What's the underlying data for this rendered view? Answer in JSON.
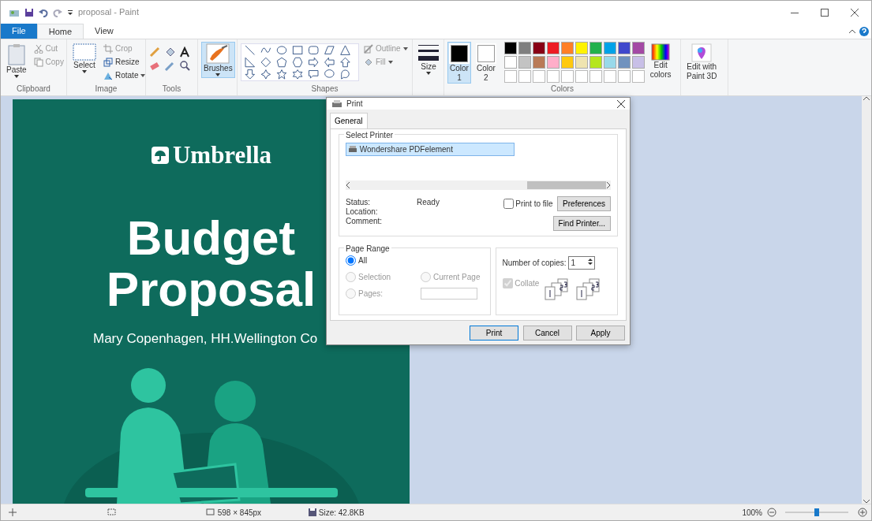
{
  "window": {
    "title": "proposal - Paint"
  },
  "menu_tabs": [
    {
      "label": "File",
      "kind": "file",
      "selected": false
    },
    {
      "label": "Home",
      "kind": "tab",
      "selected": true
    },
    {
      "label": "View",
      "kind": "tab",
      "selected": false
    }
  ],
  "ribbon": {
    "clipboard": {
      "label": "Clipboard",
      "paste": "Paste",
      "cut": {
        "label": "Cut",
        "disabled": true
      },
      "copy": {
        "label": "Copy",
        "disabled": true
      }
    },
    "image": {
      "label": "Image",
      "select": "Select",
      "crop": {
        "label": "Crop",
        "disabled": true
      },
      "resize": {
        "label": "Resize",
        "disabled": false
      },
      "rotate": {
        "label": "Rotate",
        "disabled": false
      }
    },
    "tools": {
      "label": "Tools"
    },
    "brushes": {
      "label": "Brushes",
      "selected": true
    },
    "shapes": {
      "label": "Shapes",
      "outline": {
        "label": "Outline",
        "disabled": true
      },
      "fill": {
        "label": "Fill",
        "disabled": true
      }
    },
    "size": {
      "label": "Size"
    },
    "color1": {
      "label": "Color",
      "sub": "1",
      "color": "#000000",
      "selected": true
    },
    "color2": {
      "label": "Color",
      "sub": "2",
      "color": "#ffffff",
      "selected": false
    },
    "colors": {
      "label": "Colors",
      "palette": [
        {
          "color": "#000000"
        },
        {
          "color": "#7f7f7f"
        },
        {
          "color": "#880015"
        },
        {
          "color": "#ed1c24"
        },
        {
          "color": "#ff7f27"
        },
        {
          "color": "#fff200"
        },
        {
          "color": "#22b14c"
        },
        {
          "color": "#00a2e8"
        },
        {
          "color": "#3f48cc"
        },
        {
          "color": "#a349a4"
        },
        {
          "color": "#ffffff"
        },
        {
          "color": "#c3c3c3"
        },
        {
          "color": "#b97a57"
        },
        {
          "color": "#ffaec9"
        },
        {
          "color": "#ffc90e"
        },
        {
          "color": "#efe4b0"
        },
        {
          "color": "#b5e61d"
        },
        {
          "color": "#99d9ea"
        },
        {
          "color": "#7092be"
        },
        {
          "color": "#c8bfe7"
        }
      ]
    },
    "edit_colors": [
      "Edit",
      "colors"
    ],
    "paint3d": [
      "Edit with",
      "Paint 3D"
    ]
  },
  "document": {
    "brand": "Umbrella",
    "title": [
      "Budget",
      "Proposal"
    ],
    "author": "Mary Copenhagen, HH.Wellington Co"
  },
  "dialog": {
    "title": "Print",
    "tabs": [
      {
        "label": "General",
        "selected": true
      }
    ],
    "select_printer": {
      "label": "Select Printer",
      "printers": [
        {
          "name": "Wondershare PDFelement",
          "selected": true
        }
      ]
    },
    "status": [
      {
        "label": "Status:",
        "value": "Ready"
      },
      {
        "label": "Location:"
      },
      {
        "label": "Comment:"
      }
    ],
    "print_to_file": {
      "label": "Print to file",
      "checked": false
    },
    "preferences": "Preferences",
    "find_printer": "Find Printer...",
    "page_range": {
      "label": "Page Range",
      "options": [
        {
          "label": "All",
          "selected": true,
          "disabled": false
        },
        {
          "label": "Selection",
          "selected": false,
          "disabled": true
        },
        {
          "label": "Current Page",
          "selected": false,
          "disabled": true
        },
        {
          "label": "Pages:",
          "selected": false,
          "disabled": true
        }
      ]
    },
    "copies": {
      "label": "Number of copies:",
      "value": "1"
    },
    "collate": {
      "label": "Collate",
      "checked": true,
      "disabled": true
    },
    "buttons": [
      {
        "label": "Print",
        "default": true
      },
      {
        "label": "Cancel",
        "default": false
      },
      {
        "label": "Apply",
        "default": false
      }
    ]
  },
  "status_bar": {
    "dimensions": "598 × 845px",
    "size": "Size: 42.8KB",
    "zoom": "100%",
    "zoom_level": {
      "level": 0.5
    }
  }
}
